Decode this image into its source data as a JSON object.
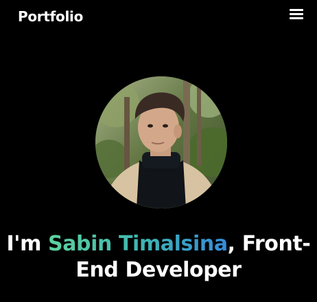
{
  "navbar": {
    "brand": "Portfolio",
    "menu_icon": "hamburger-menu-icon"
  },
  "hero": {
    "avatar_icon": "profile-photo",
    "greeting": "I'm ",
    "name": "Sabin Timalsina",
    "role_line1_suffix": ", Front-",
    "role_line2": "End Developer",
    "gradient_colors": [
      "#5dd39e",
      "#3fb6b0",
      "#348cdb"
    ]
  }
}
